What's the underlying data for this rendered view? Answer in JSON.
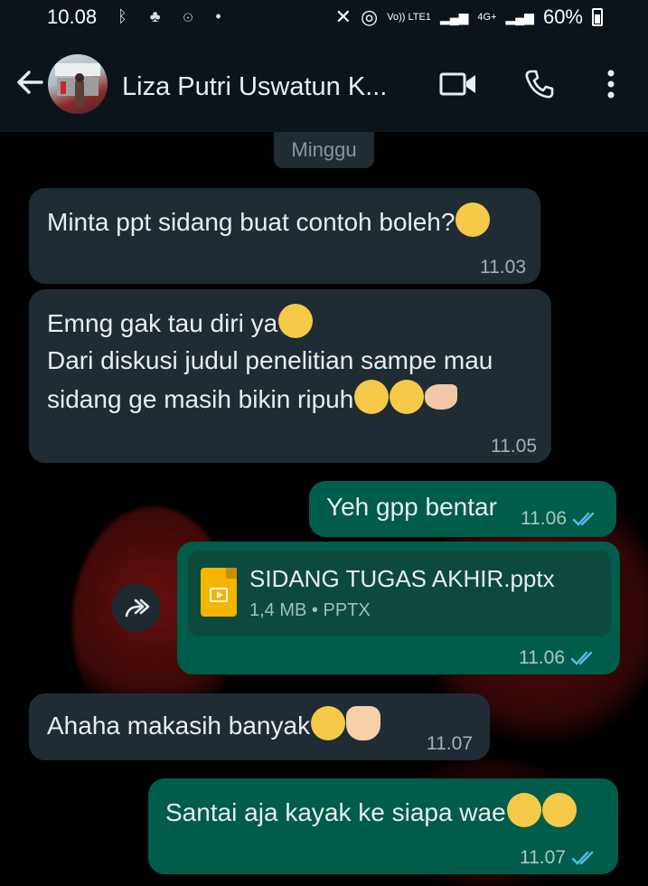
{
  "status_bar": {
    "time": "10.08",
    "volte": "Vo)) LTE1",
    "network": "4G+",
    "battery": "60%"
  },
  "header": {
    "contact_name": "Liza Putri Uswatun K..."
  },
  "date_separator": "Minggu",
  "messages": [
    {
      "dir": "in",
      "text": "Minta ppt sidang buat contoh boleh?",
      "time": "11.03"
    },
    {
      "dir": "in",
      "line1": "Emng gak tau diri ya",
      "line2": "Dari diskusi judul penelitian sampe mau",
      "line3": "sidang ge masih bikin ripuh",
      "time": "11.05"
    },
    {
      "dir": "out",
      "text": "Yeh gpp bentar",
      "time": "11.06"
    },
    {
      "dir": "out",
      "doc_name": "SIDANG TUGAS AKHIR.pptx",
      "doc_meta": "1,4 MB • PPTX",
      "time": "11.06"
    },
    {
      "dir": "in",
      "text": "Ahaha makasih banyak",
      "time": "11.07"
    },
    {
      "dir": "out",
      "text": "Santai aja kayak ke siapa wae",
      "time": "11.07"
    }
  ],
  "icons": {
    "back": "arrow-left-icon",
    "video": "video-camera-icon",
    "call": "phone-icon",
    "more": "more-vert-icon",
    "forward": "forward-icon",
    "read": "double-check-icon"
  },
  "colors": {
    "incoming": "#1f2c34",
    "outgoing": "#005c4b",
    "read_ticks": "#53bdeb",
    "header": "#0b141a"
  }
}
